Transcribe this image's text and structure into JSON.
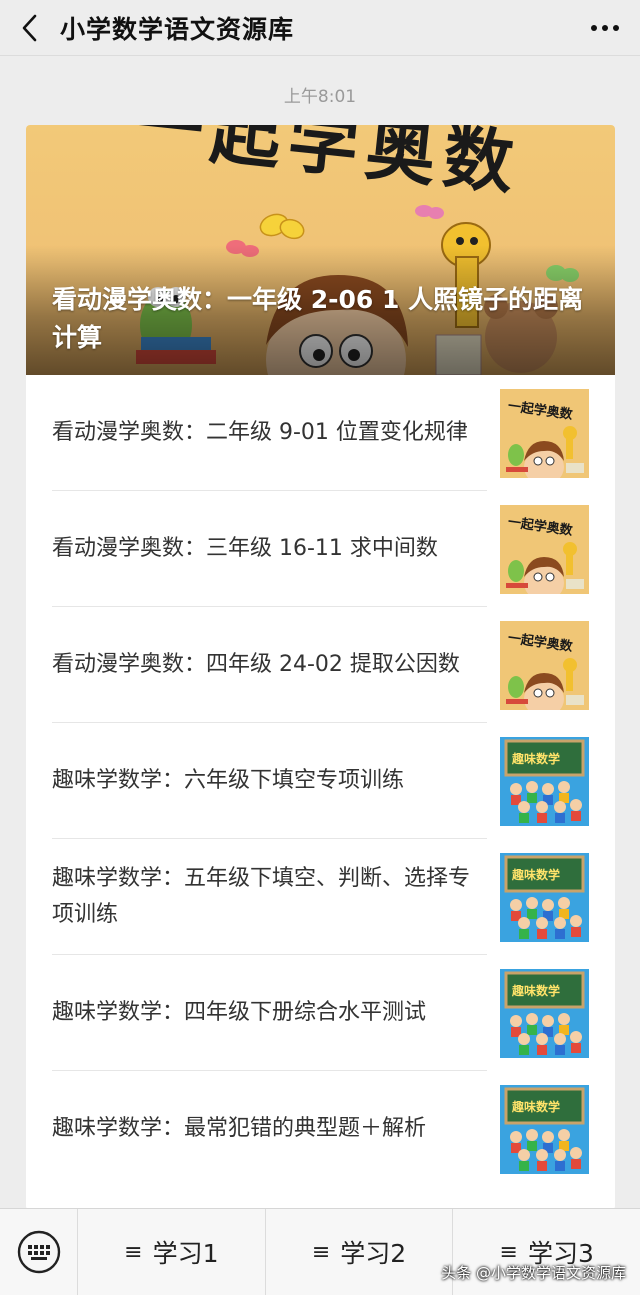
{
  "header": {
    "back_icon": "chevron-left-icon",
    "title": "小学数学语文资源库",
    "more_icon": "more-horizontal-icon"
  },
  "timestamp": "上午8:01",
  "hero": {
    "title": "看动漫学奥数：一年级 2-06 1 人照镜子的距离计算",
    "image_text": "一起学奥数"
  },
  "articles": [
    {
      "title": "看动漫学奥数：二年级 9-01 位置变化规律",
      "thumb": "anime-math"
    },
    {
      "title": "看动漫学奥数：三年级 16-11 求中间数",
      "thumb": "anime-math"
    },
    {
      "title": "看动漫学奥数：四年级 24-02 提取公因数",
      "thumb": "anime-math"
    },
    {
      "title": "趣味学数学：六年级下填空专项训练",
      "thumb": "fun-math"
    },
    {
      "title": "趣味学数学：五年级下填空、判断、选择专项训练",
      "thumb": "fun-math"
    },
    {
      "title": "趣味学数学：四年级下册综合水平测试",
      "thumb": "fun-math"
    },
    {
      "title": "趣味学数学：最常犯错的典型题＋解析",
      "thumb": "fun-math"
    }
  ],
  "thumb_text": {
    "anime": "一起学奥数",
    "fun": "趣味数学"
  },
  "bottom_menu": {
    "keyboard_icon": "keyboard-icon",
    "items": [
      {
        "icon": "≡",
        "label": "学习1"
      },
      {
        "icon": "≡",
        "label": "学习2"
      },
      {
        "icon": "≡",
        "label": "学习3"
      }
    ]
  },
  "watermark": "头条 @小学数学语文资源库"
}
